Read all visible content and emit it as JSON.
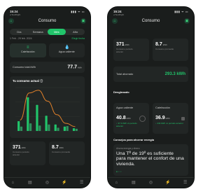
{
  "screen1": {
    "status": {
      "time": "15:24",
      "sub": "◂ TestFlight",
      "signal": "▮▮▮ ᯤ ▭"
    },
    "title": "Consumo",
    "segments": [
      "Día",
      "Semana",
      "Mes",
      "Año"
    ],
    "active_segment_index": 2,
    "date_range": "1 Feb - 29 feb. 2024",
    "date_action": "Elegir fecha",
    "categories": [
      {
        "label": "Calefacción",
        "icon": "radiator-icon"
      },
      {
        "label": "Agua caliente",
        "icon": "droplet-icon"
      }
    ],
    "total_row": {
      "label": "Consumo total kWh",
      "value": "77.7",
      "unit": "kWh"
    },
    "chart_title": "Tu consumo actual ⓘ",
    "chart_data": {
      "type": "bar",
      "categories": [
        "1",
        "2",
        "3",
        "4",
        "5",
        "6",
        "7"
      ],
      "series": [
        {
          "values": [
            18,
            62,
            48,
            28,
            12,
            8,
            5
          ]
        },
        {
          "values": [
            8,
            14,
            10,
            12,
            6,
            9,
            4
          ]
        }
      ],
      "line": [
        20,
        70,
        75,
        55,
        30,
        14,
        8
      ],
      "ylim": [
        0,
        80
      ]
    },
    "mini_cards": [
      {
        "value": "371",
        "unit": "kWh",
        "caption": "Consumo periodo anterior"
      },
      {
        "value": "8.7",
        "unit": "kWh",
        "caption": "Consumo promedio"
      }
    ],
    "nav": [
      "⌂",
      "▤",
      "◎",
      "⚡",
      "☰"
    ]
  },
  "screen2": {
    "status": {
      "time": "15:24",
      "sub": "◂ TestFlight",
      "signal": "▮▮▮ ᯤ ▭"
    },
    "title": "Consumo",
    "mini_cards": [
      {
        "value": "371",
        "unit": "kWh",
        "caption": "Consumo periodo anterior"
      },
      {
        "value": "8.7",
        "unit": "kWh",
        "caption": "Consumo promedio"
      }
    ],
    "total_saved": {
      "label": "Total ahorrado",
      "value": "293.3 kWh"
    },
    "breakdown_title": "Desglosado",
    "breakdown": [
      {
        "label": "Agua caliente",
        "value": "40.8",
        "unit": "kWh",
        "caption": "↓ 37.3 kWh vs periodo anterior"
      },
      {
        "label": "Calefacción",
        "value": "36.9",
        "unit": "kWh",
        "caption": "↓ 243 kWh vs periodo anterior"
      }
    ],
    "tips_title": "Consejos para ahorrar energía",
    "tip": {
      "tag": "Ahorra energía y dinero",
      "text": "Una Tª de 19º es suficiente para mantener el confort de una vivienda.",
      "pager": "● ○ ○"
    },
    "nav": [
      "⌂",
      "▤",
      "◎",
      "⚡",
      "☰"
    ]
  },
  "colors": {
    "accent": "#21c46a",
    "line": "#e0802a",
    "background": "#1a1d1c",
    "card": "#222625"
  }
}
